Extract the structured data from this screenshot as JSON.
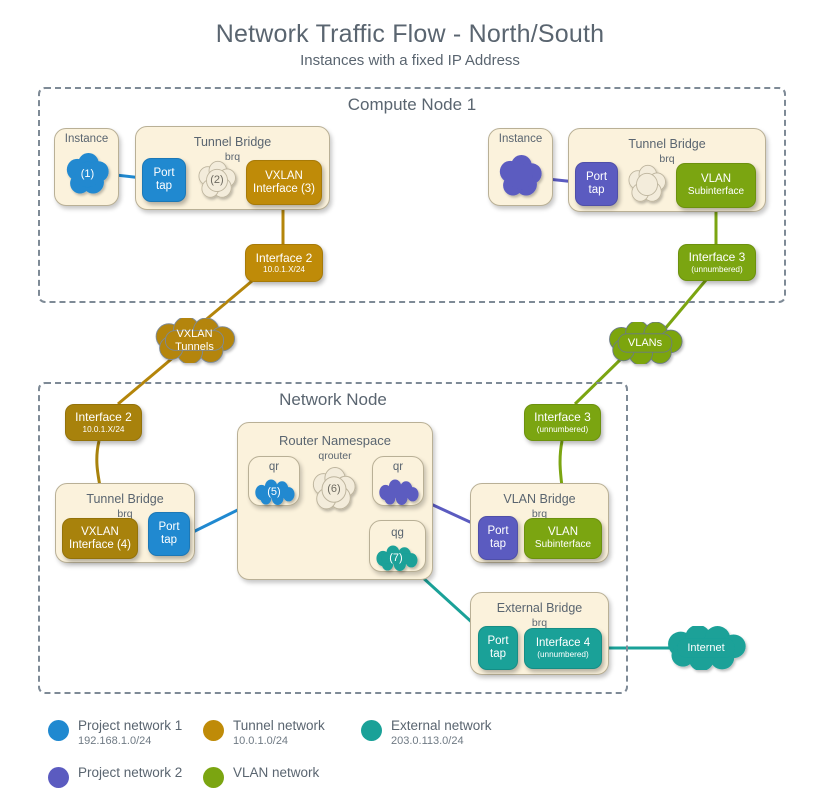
{
  "header": {
    "title": "Network Traffic Flow - North/South",
    "subtitle": "Instances with a fixed IP Address"
  },
  "colors": {
    "project_network_1": "#2089d0",
    "project_network_2": "#5b5bc0",
    "tunnel_network": "#bf8b08",
    "vlan_network": "#7ba511",
    "external_network": "#1aa198",
    "panel_fill": "#fbf2dc",
    "zone_border": "#7e8a96",
    "text_grey": "#5a6570"
  },
  "zones": [
    {
      "id": "compute",
      "title": "Compute Node 1"
    },
    {
      "id": "network",
      "title": "Network Node"
    }
  ],
  "compute_node": {
    "title": "Compute Node 1",
    "left": {
      "instance": {
        "title": "Instance",
        "cloud_label": "(1)"
      },
      "bridge": {
        "title": "Tunnel Bridge",
        "subtitle": "brq"
      },
      "port_tap": {
        "line1": "Port",
        "line2": "tap"
      },
      "inner_cloud": "(2)",
      "vxlan": {
        "line1": "VXLAN",
        "line2": "Interface (3)"
      },
      "interface": {
        "line1": "Interface 2",
        "line2": "10.0.1.X/24"
      }
    },
    "right": {
      "instance": {
        "title": "Instance",
        "cloud_label": ""
      },
      "bridge": {
        "title": "Tunnel Bridge",
        "subtitle": "brq"
      },
      "port_tap": {
        "line1": "Port",
        "line2": "tap"
      },
      "inner_cloud": "",
      "vlan_sub": {
        "line1": "VLAN",
        "line2": "Subinterface"
      },
      "interface": {
        "line1": "Interface 3",
        "line2": "(unnumbered)"
      }
    }
  },
  "transit_clouds": {
    "vxlan_tunnels": {
      "line1": "VXLAN",
      "line2": "Tunnels"
    },
    "vlans": {
      "line1": "VLANs"
    }
  },
  "network_node": {
    "title": "Network Node",
    "interface_2": {
      "line1": "Interface 2",
      "line2": "10.0.1.X/24"
    },
    "interface_3": {
      "line1": "Interface 3",
      "line2": "(unnumbered)"
    },
    "tunnel_bridge": {
      "title": "Tunnel Bridge",
      "subtitle": "brq",
      "vxlan": {
        "line1": "VXLAN",
        "line2": "Interface (4)"
      },
      "port_tap": {
        "line1": "Port",
        "line2": "tap"
      }
    },
    "router_namespace": {
      "title": "Router Namespace",
      "subtitle": "qrouter",
      "qr_left": {
        "title": "qr",
        "cloud_label": "(5)"
      },
      "center_cloud": "(6)",
      "qr_right": {
        "title": "qr",
        "cloud_label": ""
      },
      "qg": {
        "title": "qg",
        "cloud_label": "(7)"
      }
    },
    "vlan_bridge": {
      "title": "VLAN Bridge",
      "subtitle": "brq",
      "port_tap": {
        "line1": "Port",
        "line2": "tap"
      },
      "vlan_sub": {
        "line1": "VLAN",
        "line2": "Subinterface"
      }
    },
    "external_bridge": {
      "title": "External Bridge",
      "subtitle": "brq",
      "port_tap": {
        "line1": "Port",
        "line2": "tap"
      },
      "interface_4": {
        "line1": "Interface 4",
        "line2": "(unnumbered)"
      }
    }
  },
  "internet": {
    "label": "Internet"
  },
  "legend": [
    {
      "name": "Project network 1",
      "cidr": "192.168.1.0/24",
      "color": "#2089d0"
    },
    {
      "name": "Tunnel network",
      "cidr": "10.0.1.0/24",
      "color": "#bf8b08"
    },
    {
      "name": "External network",
      "cidr": "203.0.113.0/24",
      "color": "#1aa198"
    },
    {
      "name": "Project network 2",
      "cidr": "",
      "color": "#5b5bc0"
    },
    {
      "name": "VLAN network",
      "cidr": "",
      "color": "#7ba511"
    }
  ]
}
